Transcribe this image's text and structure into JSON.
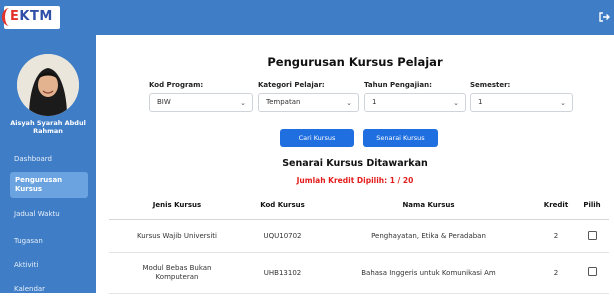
{
  "header": {
    "logo_text": "EKTM",
    "logout_icon": "logout-icon"
  },
  "sidebar": {
    "user_name": "Aisyah Syarah Abdul Rahman",
    "items": [
      {
        "label": "Dashboard",
        "active": false
      },
      {
        "label": "Pengurusan Kursus",
        "active": true
      },
      {
        "label": "Jadual Waktu",
        "active": false
      },
      {
        "label": "Tugasan",
        "active": false
      },
      {
        "label": "Aktiviti",
        "active": false
      },
      {
        "label": "Kalendar",
        "active": false
      }
    ]
  },
  "main": {
    "title": "Pengurusan Kursus Pelajar",
    "filters": {
      "program": {
        "label": "Kod Program:",
        "value": "BIW"
      },
      "kategori": {
        "label": "Kategori Pelajar:",
        "value": "Tempatan"
      },
      "tahun": {
        "label": "Tahun Pengajian:",
        "value": "1"
      },
      "semester": {
        "label": "Semester:",
        "value": "1"
      }
    },
    "buttons": {
      "cari": "Cari Kursus",
      "senarai": "Senarai Kursus"
    },
    "list_title": "Senarai Kursus Ditawarkan",
    "credit_text": "Jumlah Kredit Dipilih: 1 / 20",
    "table": {
      "headers": [
        "Jenis Kursus",
        "Kod Kursus",
        "Nama Kursus",
        "Kredit",
        "Pilih"
      ],
      "rows": [
        {
          "jenis": "Kursus Wajib Universiti",
          "kod": "UQU10702",
          "nama": "Penghayatan, Etika & Peradaban",
          "kredit": "2"
        },
        {
          "jenis_line1": "Modul Bebas Bukan",
          "jenis_line2": "Komputeran",
          "kod": "UHB13102",
          "nama": "Bahasa Inggeris untuk Komunikasi Am",
          "kredit": "2"
        }
      ]
    }
  },
  "colors": {
    "primary": "#3f7ec6",
    "button": "#1f6fe0",
    "credit": "#e31c1c"
  }
}
